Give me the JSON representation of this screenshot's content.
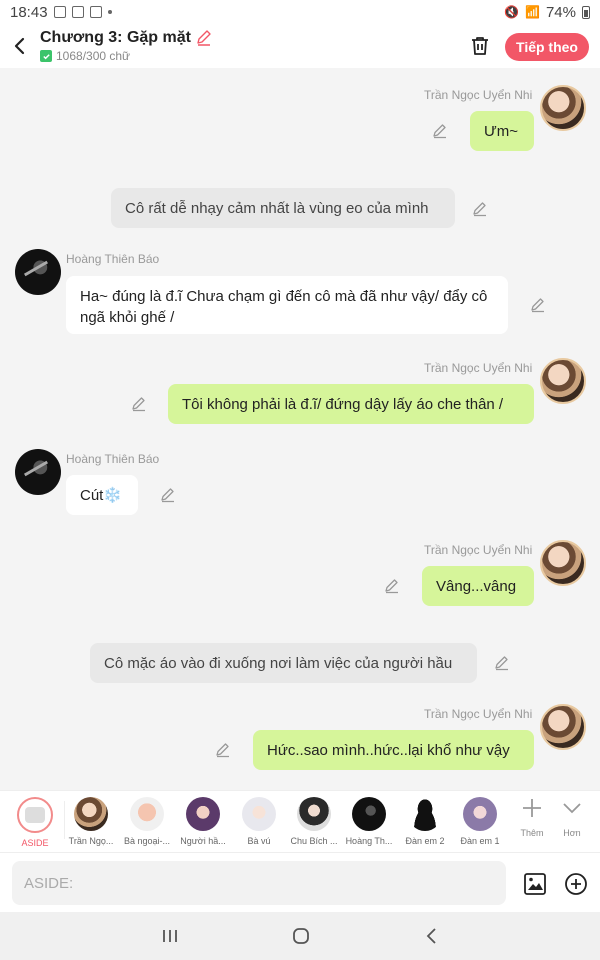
{
  "status_bar": {
    "time": "18:43",
    "battery": "74%"
  },
  "header": {
    "title": "Chương 3: Gặp mặt",
    "word_count": "1068/300 chữ",
    "next_label": "Tiếp theo",
    "accent_color": "#f25767"
  },
  "messages": [
    {
      "side": "right",
      "sender": "Trần Ngọc Uyển Nhi",
      "text": "Ưm~",
      "style": "green"
    },
    {
      "side": "center",
      "text": "Cô rất dễ nhạy cảm nhất là vùng eo của mình",
      "style": "gray"
    },
    {
      "side": "left",
      "sender": "Hoàng Thiên Báo",
      "text": "Ha~ đúng là đ.ĩ Chưa chạm gì đến cô mà đã như vậy/ đẩy cô ngã khỏi ghế /",
      "style": "white"
    },
    {
      "side": "right",
      "sender": "Trần Ngọc Uyển Nhi",
      "text": "Tôi không phải là đ.ĩ/ đứng dậy lấy áo che thân /",
      "style": "green"
    },
    {
      "side": "left",
      "sender": "Hoàng Thiên Báo",
      "text": "Cút❄️",
      "style": "white"
    },
    {
      "side": "right",
      "sender": "Trần Ngọc Uyển Nhi",
      "text": "Vâng...vâng",
      "style": "green"
    },
    {
      "side": "center",
      "text": "Cô mặc áo vào đi xuống nơi làm việc của người hầu",
      "style": "gray"
    },
    {
      "side": "right",
      "sender": "Trần Ngọc Uyển Nhi",
      "text": "Hức..sao mình..hức..lại khổ như vậy",
      "style": "green"
    }
  ],
  "characters": [
    {
      "name": "ASIDE"
    },
    {
      "name": "Trần Ngọ..."
    },
    {
      "name": "Bà ngoại-..."
    },
    {
      "name": "Người hầ..."
    },
    {
      "name": "Bà vú"
    },
    {
      "name": "Chu Bích ..."
    },
    {
      "name": "Hoàng Th..."
    },
    {
      "name": "Đàn em 2"
    },
    {
      "name": "Đàn em 1"
    }
  ],
  "tools": {
    "add_label": "Thêm",
    "more_label": "Hơn"
  },
  "input": {
    "placeholder": "ASIDE:"
  },
  "colors": {
    "green_bubble": "#d6f59a",
    "background": "#f4f4f4"
  }
}
